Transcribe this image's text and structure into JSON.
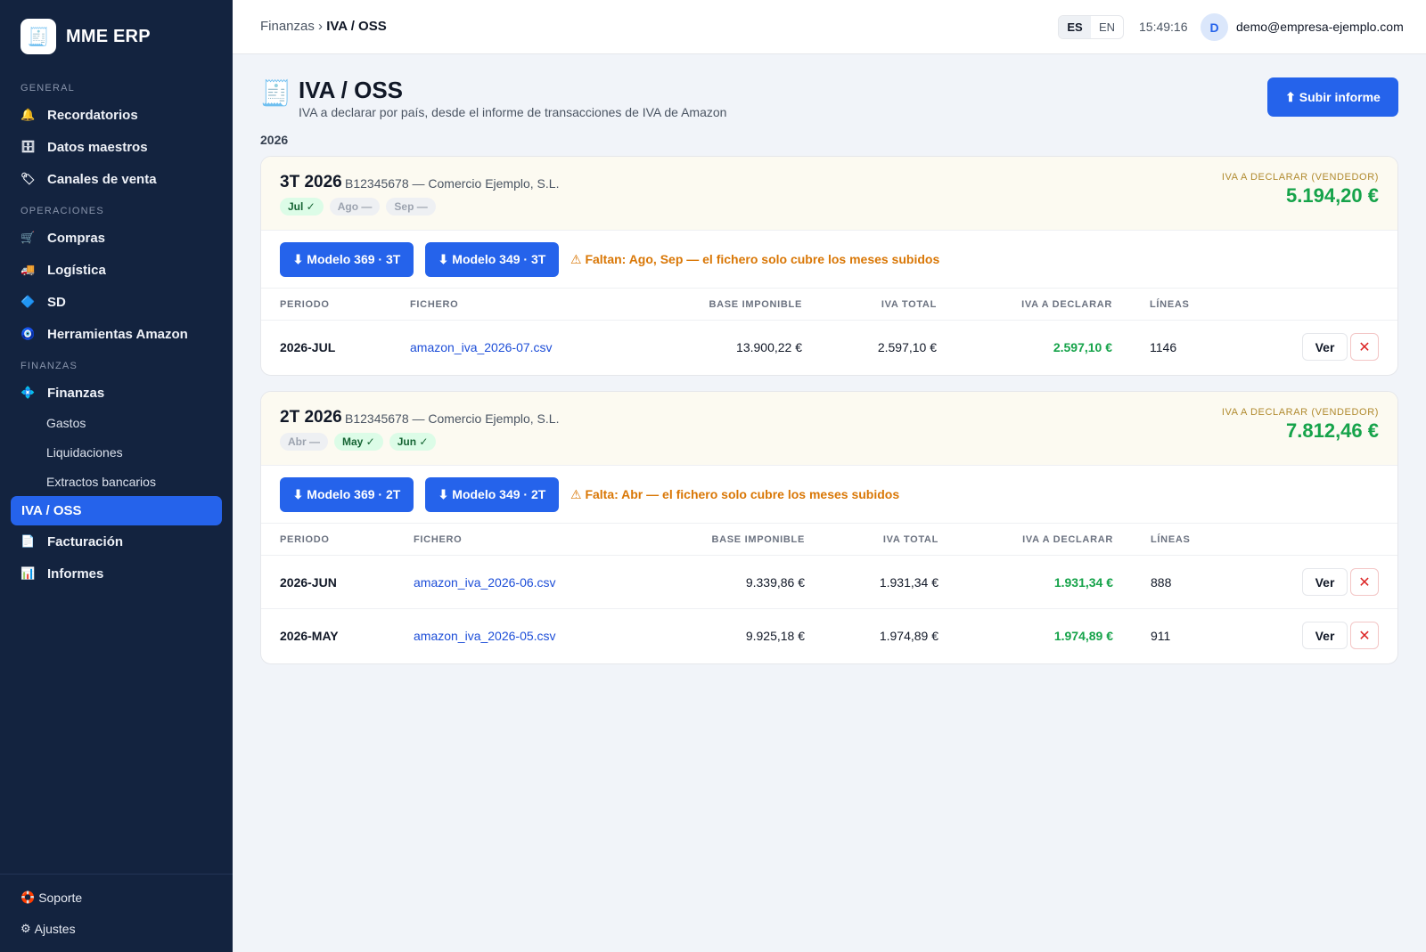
{
  "brand": {
    "logo_icon": "receipt-icon",
    "name": "MME ERP"
  },
  "sidebar": {
    "sections": [
      "GENERAL",
      "OPERACIONES",
      "FINANZAS"
    ],
    "items": [
      {
        "icon": "bell-icon",
        "label": "Recordatorios"
      },
      {
        "icon": "database-icon",
        "label": "Datos maestros"
      },
      {
        "icon": "tag-icon",
        "label": "Canales de venta"
      },
      {
        "icon": "cart-icon",
        "label": "Compras"
      },
      {
        "icon": "truck-icon",
        "label": "Logística"
      },
      {
        "icon": "diamond-icon",
        "label": "SD"
      },
      {
        "icon": "tools-icon",
        "label": "Herramientas Amazon"
      },
      {
        "icon": "finance-icon",
        "label": "Finanzas"
      }
    ],
    "sub_items": [
      "Gastos",
      "Liquidaciones",
      "Extractos bancarios"
    ],
    "active": "IVA / OSS",
    "after_items": [
      {
        "icon": "document-icon",
        "label": "Facturación"
      },
      {
        "icon": "bar-chart-icon",
        "label": "Informes"
      }
    ],
    "footer": [
      {
        "icon": "lifebuoy-icon",
        "label": "Soporte"
      },
      {
        "icon": "gear-icon",
        "label": "Ajustes"
      }
    ]
  },
  "topbar": {
    "breadcrumb_parent": "Finanzas",
    "breadcrumb_sep": "›",
    "breadcrumb_current": "IVA / OSS",
    "lang_es": "ES",
    "lang_en": "EN",
    "time": "15:49:16",
    "avatar_initial": "D",
    "email": "demo@empresa-ejemplo.com"
  },
  "page": {
    "icon": "receipt-icon",
    "title": "IVA / OSS",
    "subtitle": "IVA a declarar por país, desde el informe de transacciones de IVA de Amazon",
    "upload_label": "⬆ Subir informe",
    "year": "2026"
  },
  "table_headers": [
    "PERIODO",
    "FICHERO",
    "BASE IMPONIBLE",
    "IVA TOTAL",
    "IVA A DECLARAR",
    "LÍNEAS"
  ],
  "declare_label": "IVA A DECLARAR (VENDEDOR)",
  "view_label": "Ver",
  "delete_label": "✕",
  "quarters": [
    {
      "title": "3T 2026",
      "company": "B12345678 — Comercio Ejemplo, S.L.",
      "chips": [
        {
          "label": "Jul ✓",
          "ok": true
        },
        {
          "label": "Ago —",
          "ok": false
        },
        {
          "label": "Sep —",
          "ok": false
        }
      ],
      "declare_value": "5.194,20 €",
      "btn369": "⬇ Modelo 369 · 3T",
      "btn349": "⬇ Modelo 349 · 3T",
      "warning": "⚠ Faltan: Ago, Sep — el fichero solo cubre los meses subidos",
      "rows": [
        {
          "periodo": "2026-JUL",
          "fichero": "amazon_iva_2026-07.csv",
          "base": "13.900,22 €",
          "iva_total": "2.597,10 €",
          "iva_declarar": "2.597,10 €",
          "lineas": "1146"
        }
      ]
    },
    {
      "title": "2T 2026",
      "company": "B12345678 — Comercio Ejemplo, S.L.",
      "chips": [
        {
          "label": "Abr —",
          "ok": false
        },
        {
          "label": "May ✓",
          "ok": true
        },
        {
          "label": "Jun ✓",
          "ok": true
        }
      ],
      "declare_value": "7.812,46 €",
      "btn369": "⬇ Modelo 369 · 2T",
      "btn349": "⬇ Modelo 349 · 2T",
      "warning": "⚠ Falta: Abr — el fichero solo cubre los meses subidos",
      "rows": [
        {
          "periodo": "2026-JUN",
          "fichero": "amazon_iva_2026-06.csv",
          "base": "9.339,86 €",
          "iva_total": "1.931,34 €",
          "iva_declarar": "1.931,34 €",
          "lineas": "888"
        },
        {
          "periodo": "2026-MAY",
          "fichero": "amazon_iva_2026-05.csv",
          "base": "9.925,18 €",
          "iva_total": "1.974,89 €",
          "iva_declarar": "1.974,89 €",
          "lineas": "911"
        }
      ]
    }
  ]
}
